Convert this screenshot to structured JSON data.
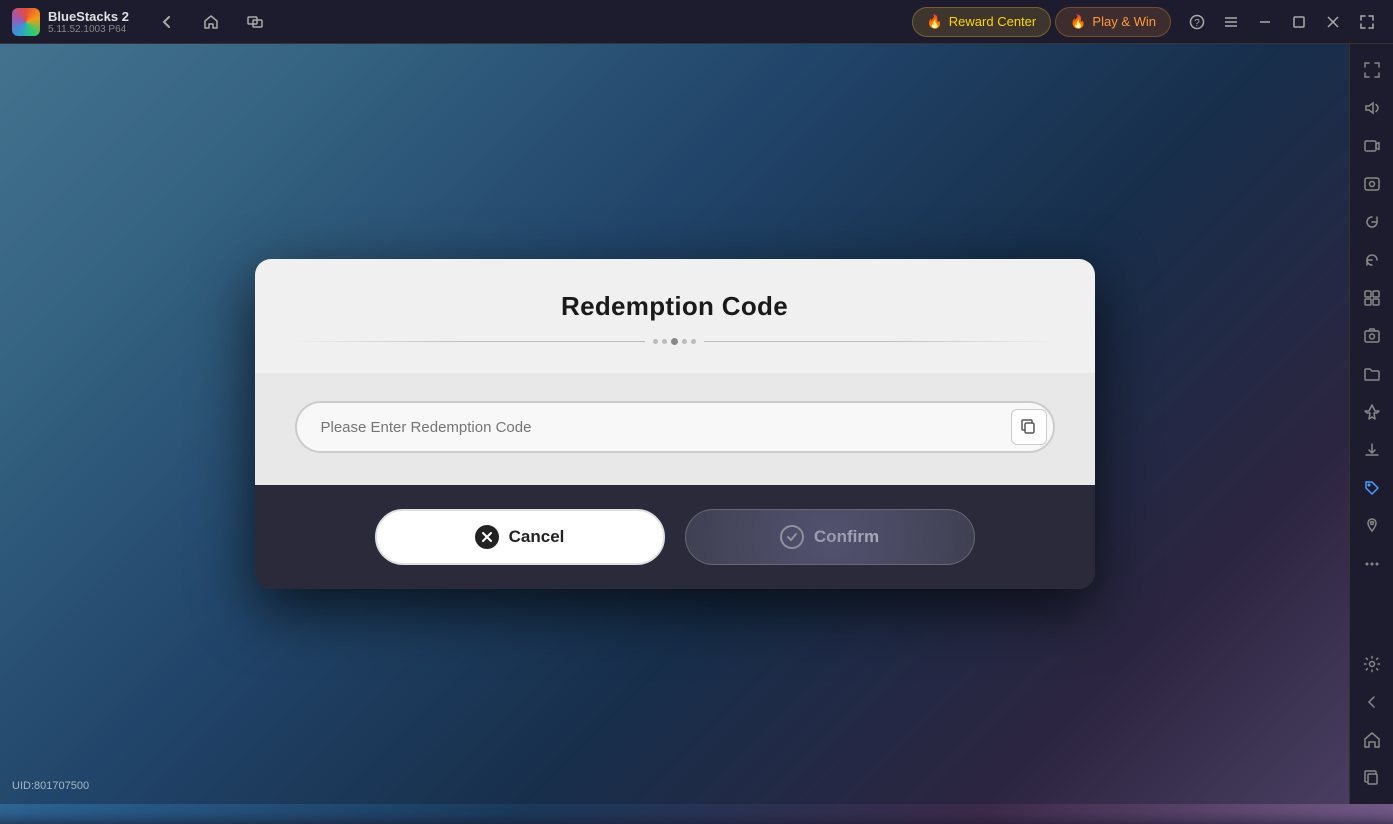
{
  "app": {
    "name": "BlueStacks 2",
    "version": "5.11.52.1003  P64"
  },
  "topbar": {
    "reward_center_label": "Reward Center",
    "play_win_label": "Play & Win",
    "reward_icon": "🔥",
    "play_icon": "🔥"
  },
  "nav": {
    "back_label": "←",
    "home_label": "⌂",
    "multi_label": "⧉"
  },
  "window_controls": {
    "help_label": "?",
    "menu_label": "≡",
    "minimize_label": "−",
    "restore_label": "⬜",
    "close_label": "✕",
    "expand_label": "⤢"
  },
  "sidebar_icons": [
    "⤢",
    "🔊",
    "▶",
    "⬛",
    "↺",
    "↻",
    "🗄",
    "📷",
    "📁",
    "✈",
    "⬛",
    "◈",
    "📍",
    "⋯",
    "⚙",
    "←",
    "⌂",
    "📋"
  ],
  "dialog": {
    "title": "Redemption Code",
    "input_placeholder": "Please Enter Redemption Code",
    "cancel_label": "Cancel",
    "confirm_label": "Confirm"
  },
  "footer": {
    "uid_label": "UID:801707500"
  }
}
